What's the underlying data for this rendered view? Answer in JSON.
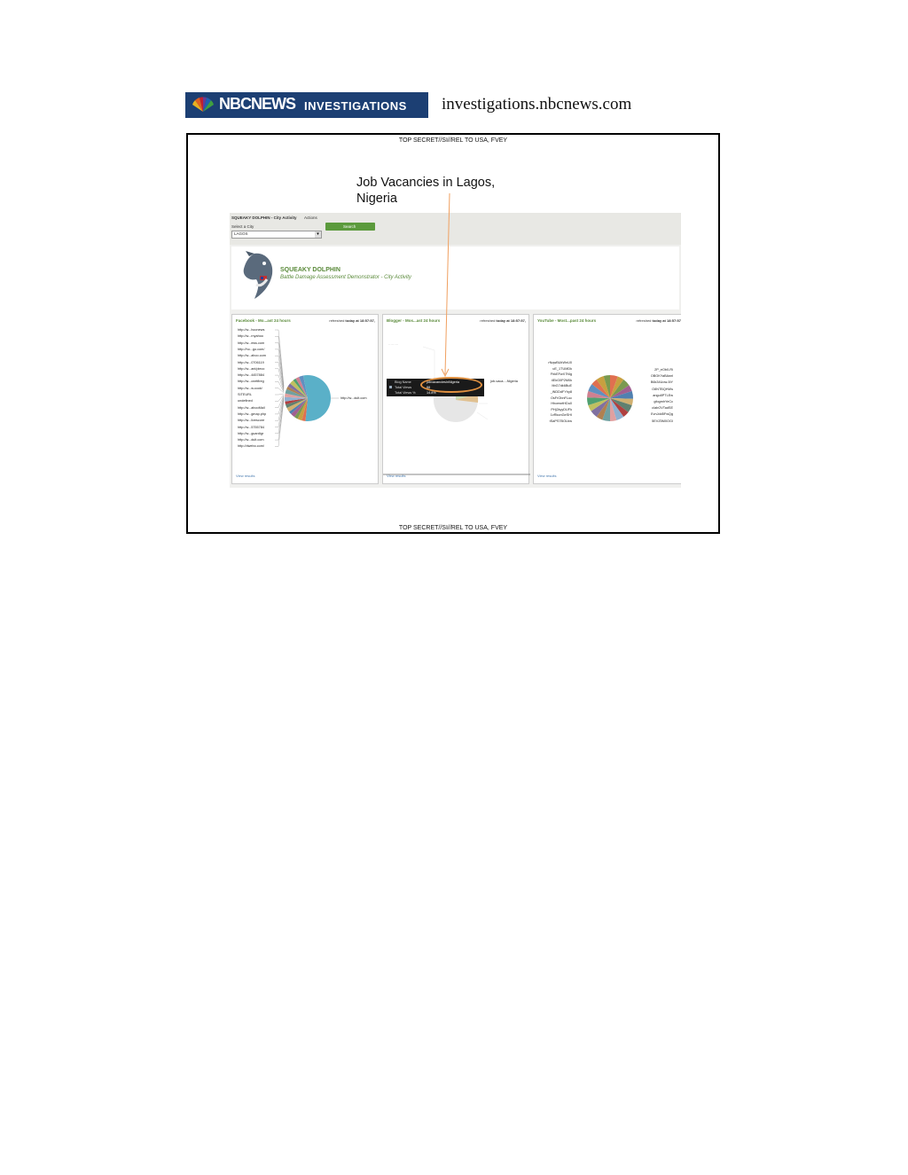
{
  "header": {
    "logo_brand": "NBCNEWS",
    "logo_section": "INVESTIGATIONS",
    "site_url": "investigations.nbcnews.com"
  },
  "slide": {
    "classification_top": "TOP SECRET//SI//REL TO USA, FVEY",
    "classification_bottom": "TOP SECRET//SI//REL TO USA, FVEY",
    "annotation_line1": "Job Vacancies in Lagos,",
    "annotation_line2": "Nigeria"
  },
  "app": {
    "title": "SQUEAKY DOLPHIN - City Activity",
    "actions_menu": "Actions",
    "city_label": "Select a City",
    "city_value": "LAGOS",
    "search_button": "Search",
    "banner_title": "SQUEAKY DOLPHIN",
    "banner_subtitle": "Battle Damage Assessment Demonstrator - City Activity"
  },
  "panels": [
    {
      "title": "Facebook - Mo...ast 24 hours",
      "refreshed_prefix": "refreshed",
      "refreshed_time": "today at 18:57:57,",
      "view_results": "View results",
      "labels_left": [
        "http://w...hoonews",
        "http://w...rnyahoo",
        "http://w...ews.com",
        "http://ho...go.com/",
        "http://w...ahoo.com",
        "http://w...0706119",
        "http://w...ani/pieco",
        "http://w...4457884",
        "http://w...cnetfireg",
        "http://w...w.cook/",
        "SITEURL",
        "undefined",
        "http://w...ahooMail",
        "http://w...gmap.php",
        "http://w...livescore",
        "http://w...5755784",
        "http://w...guardigr",
        "http://w...dult.com",
        "http://dwebo.com/"
      ],
      "label_right": "http://w...dult.com"
    },
    {
      "title": "Blogger - Mos...ast 24 hours",
      "refreshed_prefix": "refreshed",
      "refreshed_time": "today at 18:57:57,",
      "view_results": "View results",
      "tooltip_name_label": "Blog Name",
      "tooltip_name_value": "jobvacanciesinNigeria",
      "tooltip_views_label": "Total Views",
      "tooltip_views_value": "88",
      "tooltip_total_label": "Total Views %",
      "tooltip_total_value": "14.8%",
      "label_right": "job-vaca...-Nigeria"
    },
    {
      "title": "YouTube - Most...past 24 hours",
      "refreshed_prefix": "refreshed",
      "refreshed_time": "today at 18:57:57",
      "view_results": "View results",
      "labels_left": [
        "rNqwBUkWnU0",
        "uE_1TUMDk",
        "FhkEFwX7Nlg",
        "4EkG0P2M0k",
        "ItbG7dk6BuE",
        "_iNDDdFYhy8",
        "OsFrObnFLuc",
        "HhcewrtHDu0",
        "PHj2kyyDUFk",
        "1vRkonGeSHI",
        "tSaPS7BOLbw"
      ],
      "labels_right": [
        "2P_eOb0-Ri",
        "OBGKYaBAwrl",
        "B6k34Uow-5iY",
        "O8NTBQHWs",
        "ango8PTLEw",
        "gfogmhYeCc",
        "cIabOVTadSE",
        "EvnJdd5FwQg",
        "5EVZ5M0OGI"
      ]
    }
  ],
  "colors": {
    "logo_bg": "#1c3f73",
    "annotation_arrow": "#f0a060",
    "panel_title": "#5a8a3a",
    "search_button": "#5b9a3c",
    "pie_main": "#5ab0c8"
  }
}
